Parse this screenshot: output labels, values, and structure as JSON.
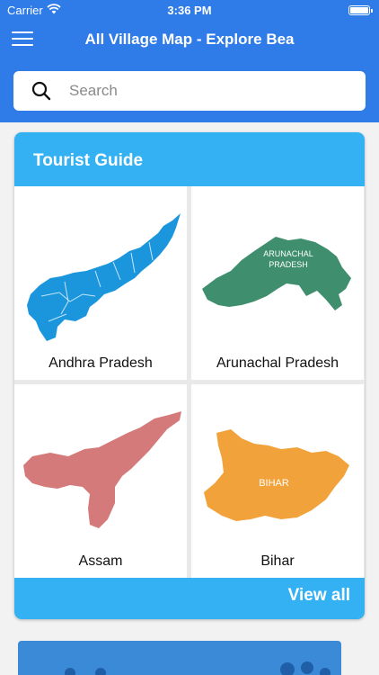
{
  "status": {
    "carrier": "Carrier",
    "time": "3:36 PM"
  },
  "nav": {
    "title": "All Village Map - Explore Bea"
  },
  "search": {
    "placeholder": "Search"
  },
  "guide": {
    "heading": "Tourist Guide",
    "states": [
      {
        "name": "Andhra Pradesh",
        "color": "#1b96dd",
        "map_label": ""
      },
      {
        "name": "Arunachal Pradesh",
        "color": "#3f8f6e",
        "map_label": "ARUNACHAL PRADESH"
      },
      {
        "name": "Assam",
        "color": "#d57a7a",
        "map_label": ""
      },
      {
        "name": "Bihar",
        "color": "#f2a23b",
        "map_label": "BIHAR"
      }
    ],
    "view_all": "View all"
  },
  "colors": {
    "primary": "#2f7be8",
    "accent": "#34b1f3"
  },
  "icons": {
    "menu": "hamburger-menu-icon",
    "search": "search-icon",
    "wifi": "wifi-icon",
    "battery": "battery-icon"
  }
}
